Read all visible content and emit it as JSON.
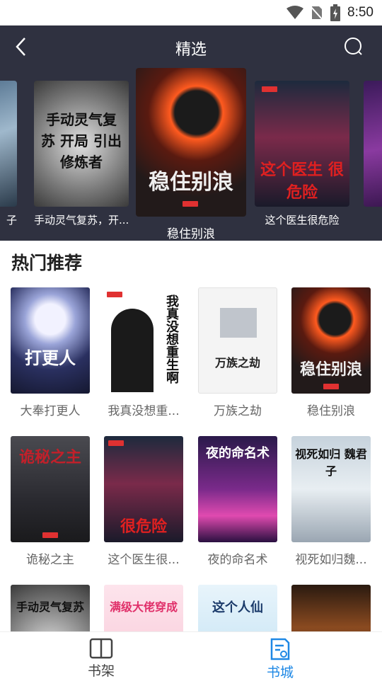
{
  "status": {
    "time": "8:50"
  },
  "header": {
    "title": "精选"
  },
  "carousel": {
    "items": [
      {
        "title": "子"
      },
      {
        "title": "手动灵气复苏，开...",
        "cover_text": "手动灵气复苏 开局 引出修炼者"
      },
      {
        "title": "稳住别浪",
        "cover_text": "稳住别浪"
      },
      {
        "title": "这个医生很危险",
        "cover_text": "这个医生 很危险"
      }
    ]
  },
  "section": {
    "title": "热门推荐"
  },
  "books": [
    {
      "title": "大奉打更人",
      "cover_text": "打更人"
    },
    {
      "title": "我真没想重...",
      "cover_text": "我真没想重生啊"
    },
    {
      "title": "万族之劫",
      "cover_text": "万族之劫"
    },
    {
      "title": "稳住别浪",
      "cover_text": "稳住别浪"
    },
    {
      "title": "诡秘之主",
      "cover_text": "诡秘之主"
    },
    {
      "title": "这个医生很...",
      "cover_text": "很危险"
    },
    {
      "title": "夜的命名术",
      "cover_text": "夜的命名术"
    },
    {
      "title": "视死如归魏...",
      "cover_text": "视死如归 魏君子"
    },
    {
      "title": "",
      "cover_text": "手动灵气复苏"
    },
    {
      "title": "",
      "cover_text": "满级大佬穿成"
    },
    {
      "title": "",
      "cover_text": "这个人仙"
    },
    {
      "title": "",
      "cover_text": ""
    }
  ],
  "nav": {
    "bookshelf": "书架",
    "store": "书城"
  },
  "colors": {
    "accent": "#1e88e5",
    "header_bg": "#2f3140"
  }
}
